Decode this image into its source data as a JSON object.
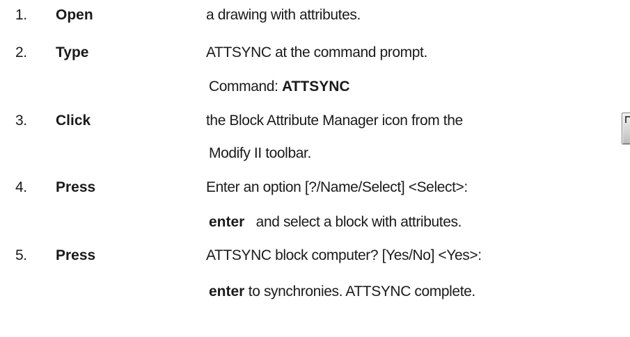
{
  "steps": [
    {
      "number": "1.",
      "verb": "Open",
      "text": "a drawing with attributes."
    },
    {
      "number": "2.",
      "verb": "Type",
      "text": "ATTSYNC at the command prompt.",
      "command_prefix": "Command: ",
      "command": "ATTSYNC"
    },
    {
      "number": "3.",
      "verb": "Click",
      "text": "the Block Attribute Manager icon from the",
      "continuation": "Modify II toolbar.",
      "icon": "block-attribute-manager-icon"
    },
    {
      "number": "4.",
      "verb": "Press",
      "text": "Enter an option [?/Name/Select] <Select>:",
      "cont_bold": "enter",
      "cont_text": "and select a block with attributes."
    },
    {
      "number": "5.",
      "verb": "Press",
      "text": "ATTSYNC block computer? [Yes/No] <Yes>:",
      "cont_bold": "enter",
      "cont_text": "to synchronies. ATTSYNC complete."
    }
  ]
}
